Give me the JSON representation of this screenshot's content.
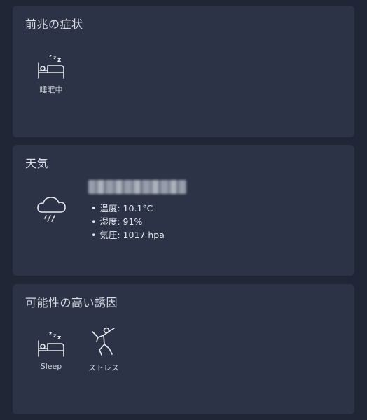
{
  "prodrome": {
    "title": "前兆の症状",
    "items": [
      {
        "label": "睡眠中",
        "icon": "sleep-bed-icon"
      }
    ]
  },
  "weather": {
    "title": "天気",
    "icon": "rain-cloud-icon",
    "location": "",
    "details": [
      {
        "text": "温度: 10.1°C"
      },
      {
        "text": "湿度: 91%"
      },
      {
        "text": "気圧: 1017 hpa"
      }
    ]
  },
  "triggers": {
    "title": "可能性の高い誘因",
    "items": [
      {
        "label": "Sleep",
        "icon": "sleep-bed-icon"
      },
      {
        "label": "ストレス",
        "icon": "stress-figure-icon"
      }
    ]
  },
  "colors": {
    "background": "#212636",
    "card": "#2c3347",
    "text": "#e4e7ee"
  }
}
